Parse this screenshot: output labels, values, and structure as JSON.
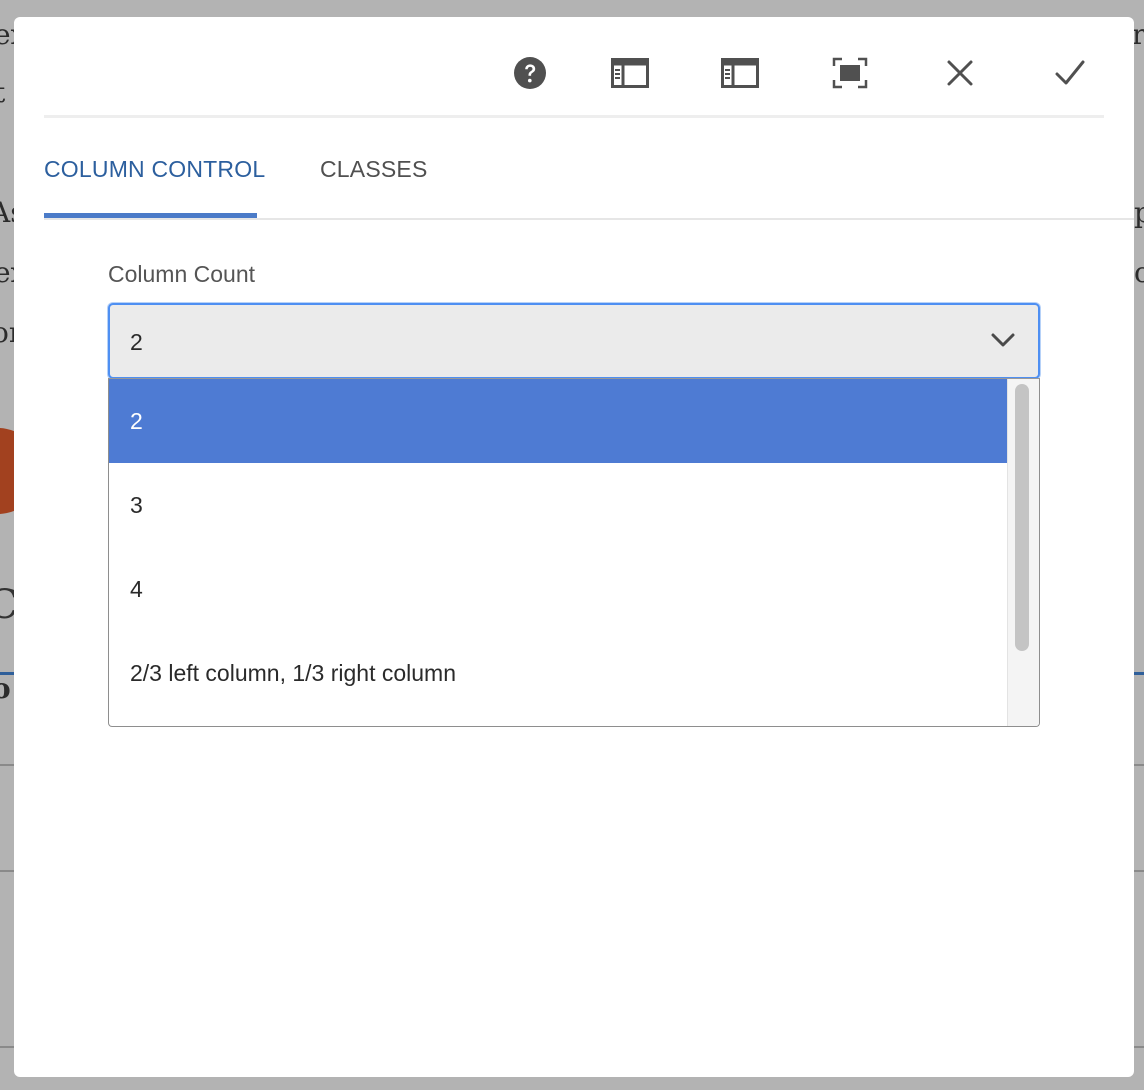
{
  "background": {
    "fragments_left": [
      "ex",
      "t",
      "As",
      "ex",
      "or",
      "C",
      "o"
    ],
    "fragments_right": [
      "r",
      "p",
      "o"
    ]
  },
  "toolbar": {
    "buttons": [
      {
        "icon": "help-icon",
        "name": "help-button"
      },
      {
        "icon": "sidepanel-left-icon",
        "name": "toggle-side-panel-button"
      },
      {
        "icon": "sidepanel-right-icon",
        "name": "toggle-side-panel-alt-button"
      },
      {
        "icon": "fullscreen-icon",
        "name": "fullscreen-button"
      },
      {
        "icon": "close-icon",
        "name": "cancel-button"
      },
      {
        "icon": "checkmark-icon",
        "name": "done-button"
      }
    ]
  },
  "tabs": [
    {
      "label": "COLUMN CONTROL",
      "active": true
    },
    {
      "label": "CLASSES",
      "active": false
    }
  ],
  "form": {
    "column_count_label": "Column Count",
    "column_count_value": "2",
    "options": [
      "2",
      "3",
      "4",
      "2/3 left column, 1/3 right column"
    ],
    "selected_index": 0
  },
  "colors": {
    "accent": "#4b7bc8",
    "active_tab_text": "#2c5f9e",
    "selected_option": "#4e7bd3",
    "focus_ring": "#4e8ff2"
  }
}
